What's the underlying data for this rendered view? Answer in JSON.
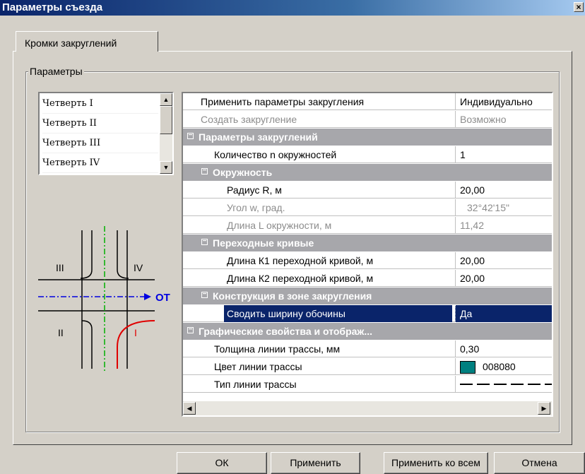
{
  "window": {
    "title": "Параметры съезда",
    "close_glyph": "×"
  },
  "tabs": [
    {
      "label": "Кромки закруглений"
    }
  ],
  "group": {
    "label": "Параметры"
  },
  "quarters": [
    "Четверть I",
    "Четверть  II",
    "Четверть  III",
    "Четверть   IV"
  ],
  "diagram": {
    "labels": [
      "III",
      "IV",
      "II",
      "I"
    ],
    "axis_label": "ОТ"
  },
  "grid": {
    "rows": [
      {
        "name": "Применить параметры закругления",
        "value": "Индивидуально"
      },
      {
        "name": "Создать закругление",
        "value": "Возможно"
      },
      {
        "name": "Параметры закруглений"
      },
      {
        "name": "Количество n окружностей",
        "value": "1"
      },
      {
        "name": "Окружность"
      },
      {
        "name": "Радиус R, м",
        "value": "20,00"
      },
      {
        "name": "Угол w, град.",
        "value": "32°42'15\""
      },
      {
        "name": "Длина L окружности, м",
        "value": "11,42"
      },
      {
        "name": "Переходные кривые"
      },
      {
        "name": "Длина К1 переходной кривой, м",
        "value": "20,00"
      },
      {
        "name": "Длина К2 переходной кривой, м",
        "value": "20,00"
      },
      {
        "name": "Конструкция в зоне закругления"
      },
      {
        "name": "Сводить ширину обочины",
        "value": "Да"
      },
      {
        "name": "Графические свойства  и отображ..."
      },
      {
        "name": "Толщина линии трассы, мм",
        "value": "0,30"
      },
      {
        "name": "Цвет линии трассы",
        "value": "008080"
      },
      {
        "name": "Тип линии трассы"
      }
    ],
    "line_color": "#008080"
  },
  "buttons": {
    "ok": "ОК",
    "apply": "Применить",
    "apply_all": "Применить ко всем",
    "cancel": "Отмена"
  }
}
